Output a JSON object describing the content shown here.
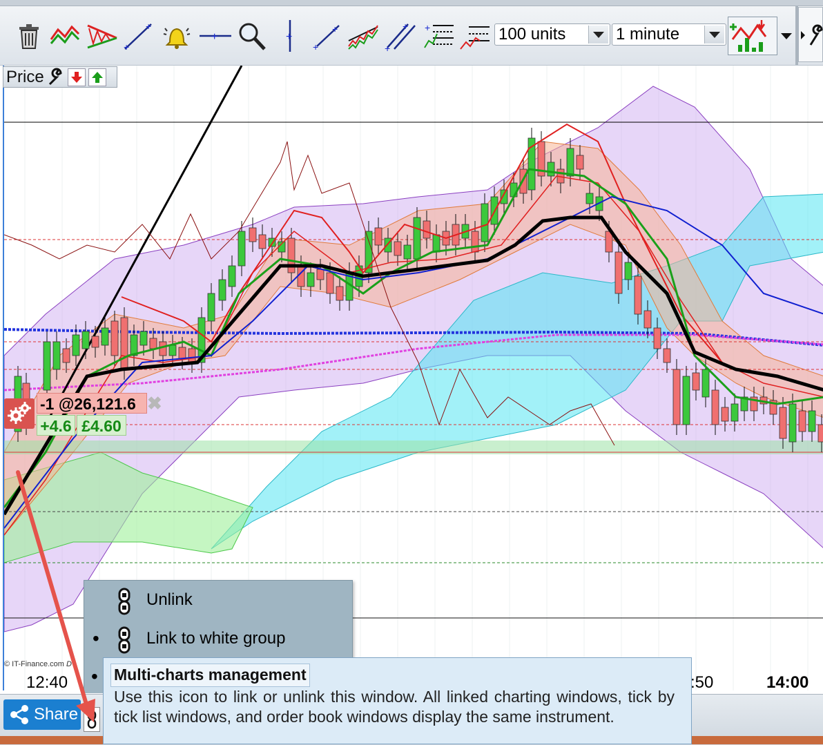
{
  "toolbar": {
    "icons": [
      "trash-icon",
      "zigzag-icon",
      "triangle-pattern-icon",
      "trendline-icon",
      "alert-bell-icon",
      "horizontal-line-icon",
      "zoom-icon",
      "vertical-line-icon",
      "ray-icon",
      "channel-icon",
      "parallel-lines-icon",
      "fibonacci-icon",
      "fan-icon",
      "indicators-icon",
      "settings-wrench-icon"
    ],
    "quantity_select": "100 units",
    "interval_select": "1 minute"
  },
  "price_panel": {
    "label": "Price"
  },
  "position": {
    "order": "-1 @26,121.6",
    "points": "+4.6",
    "value": "£4.60",
    "close_glyph": "✖"
  },
  "chart": {
    "copyright": "© IT-Finance.com",
    "copyright_suffix": "D",
    "time_labels": {
      "left": "12:40",
      "mid": ":50",
      "right": "14:00"
    },
    "colors": {
      "bull": "#3cc83c",
      "bear": "#f07070",
      "ichimoku": "#55e6f2",
      "bollinger": "#c9a5f0",
      "envelope": "#f7b596",
      "sma": "#000000"
    }
  },
  "link_menu": {
    "items": [
      {
        "label": "Unlink",
        "selected": false
      },
      {
        "label": "Link to white group",
        "selected": true
      }
    ],
    "partial_bullet": "•"
  },
  "tooltip": {
    "title": "Multi-charts management",
    "body": "Use this icon to link or unlink this window. All linked charting windows, tick by tick list windows, and order book windows display the same instrument."
  },
  "share": {
    "label": "Share"
  }
}
